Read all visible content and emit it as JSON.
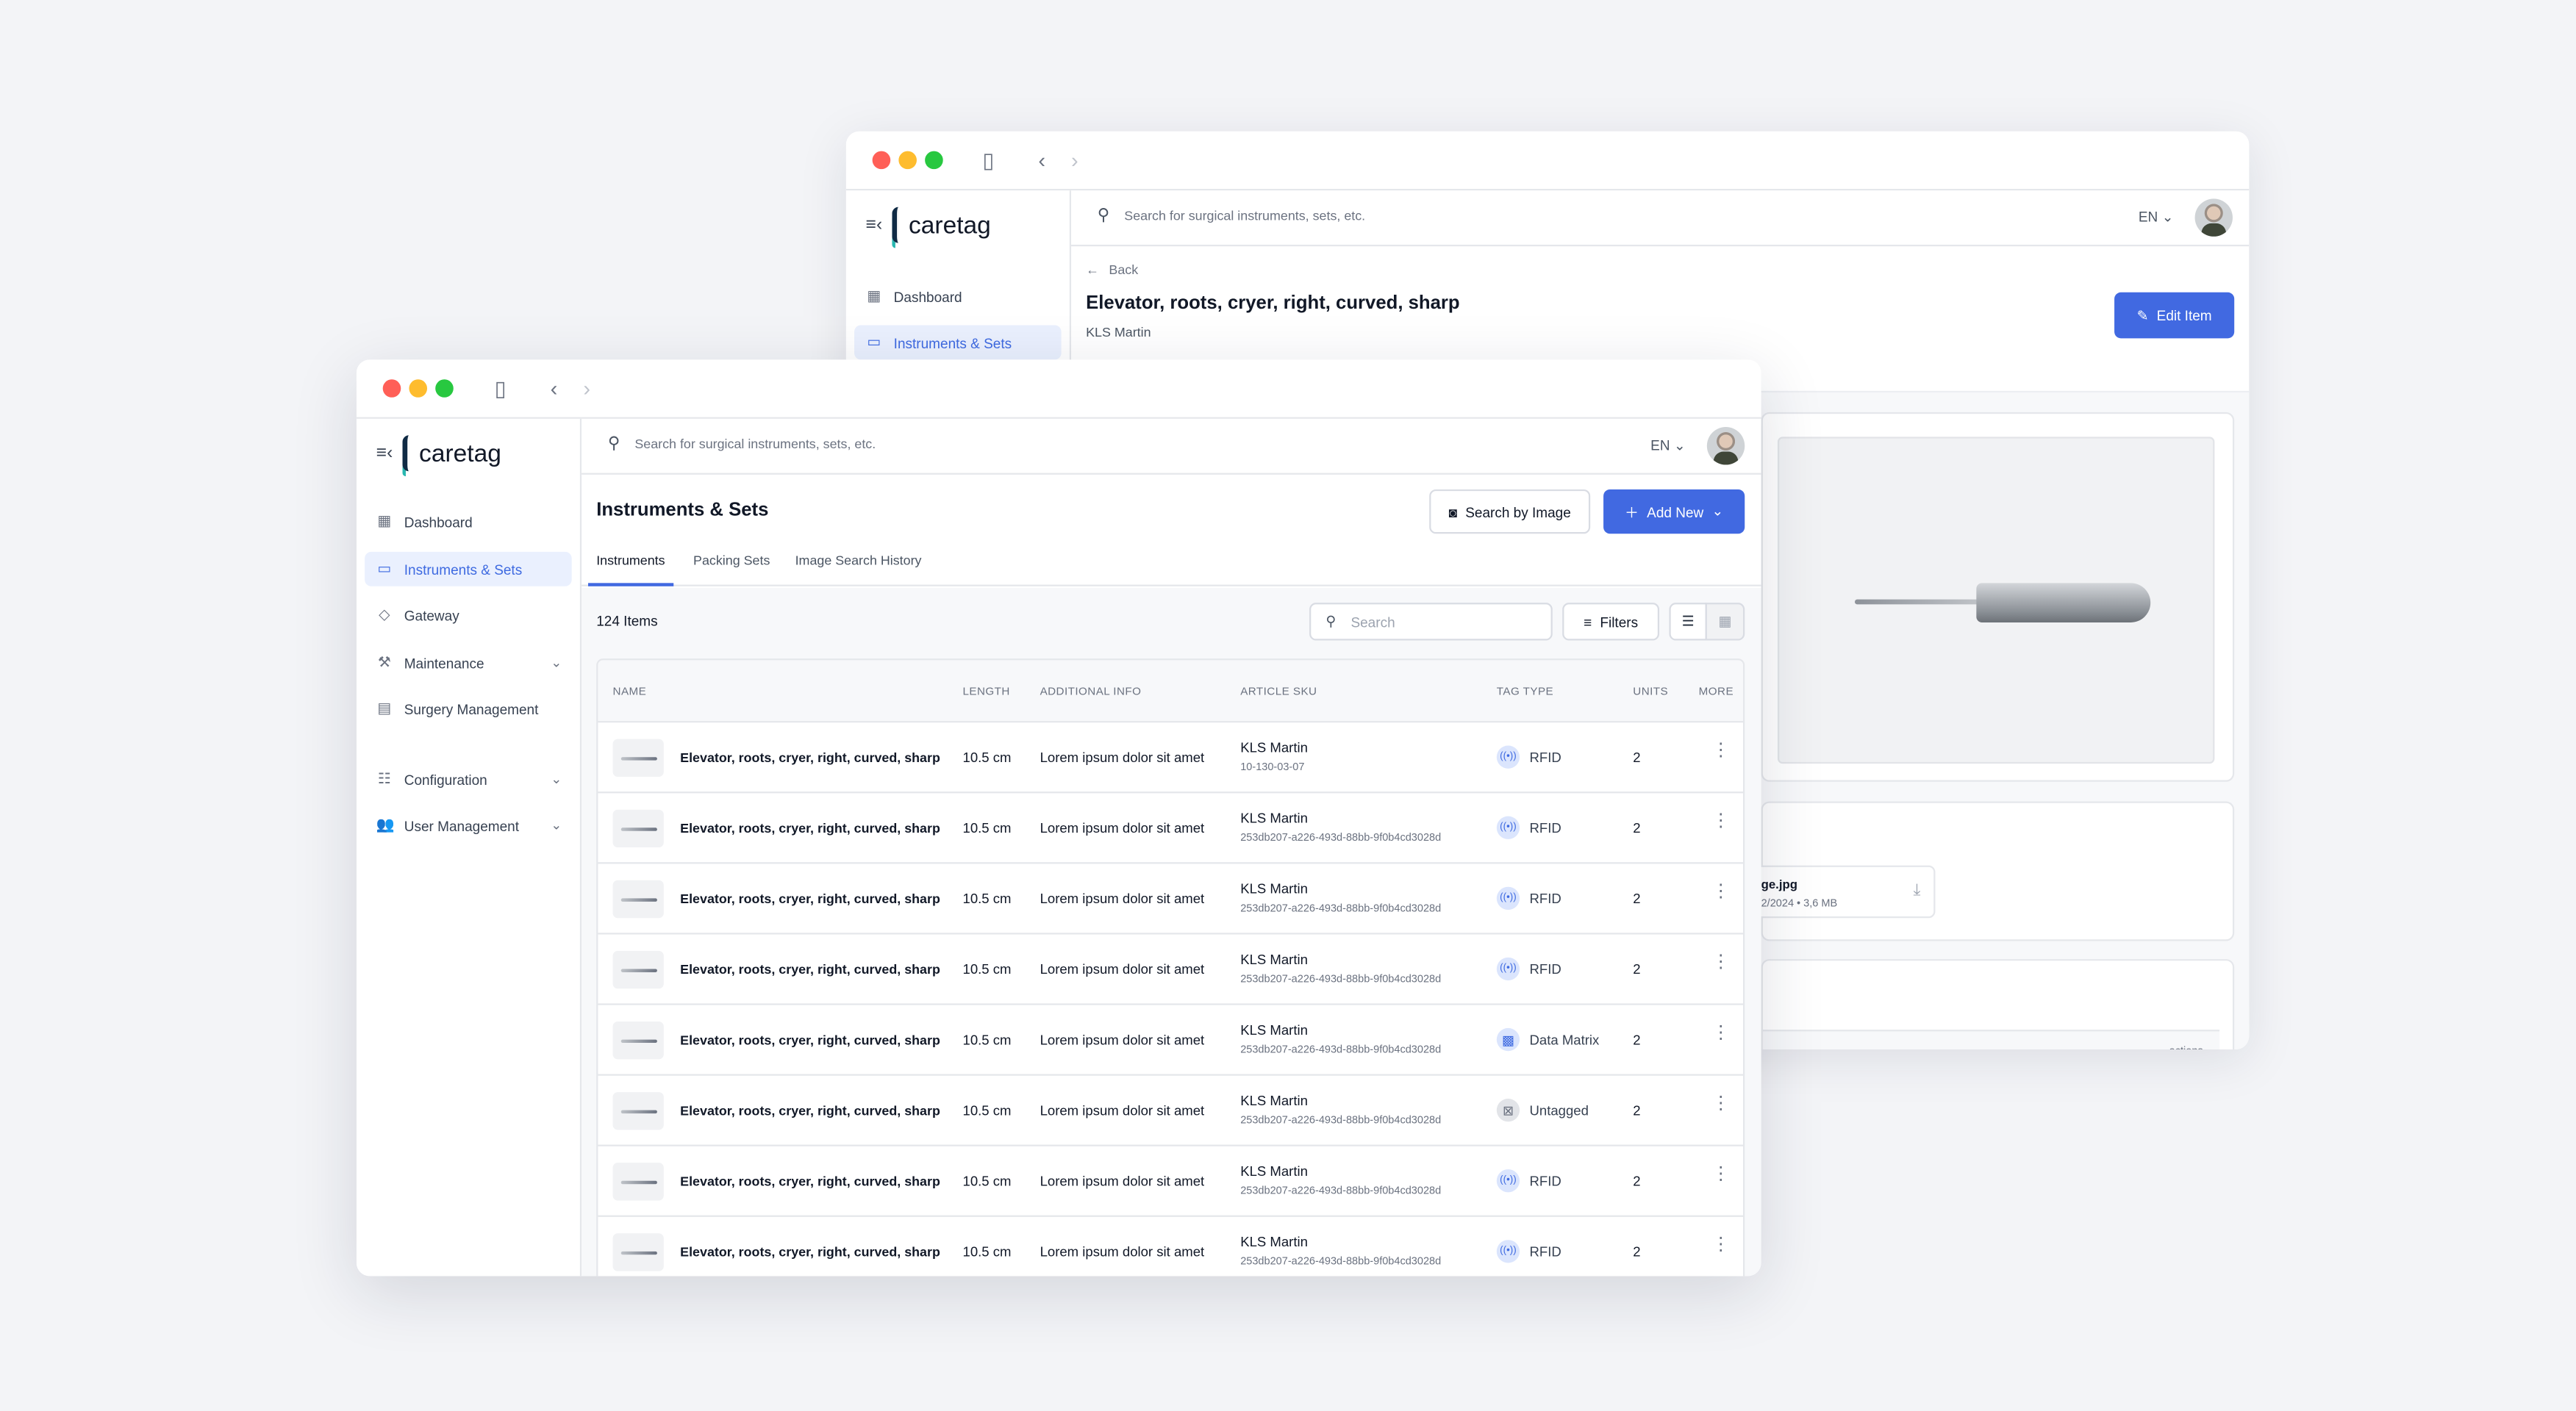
{
  "app": {
    "brand": "caretag",
    "search_placeholder": "Search for surgical instruments, sets, etc.",
    "language": "EN"
  },
  "colors": {
    "accent": "#4169e1",
    "active_nav_bg": "#eaf0fe",
    "close": "#ff5f57",
    "minimize": "#febc2e",
    "maximize": "#28c840"
  },
  "sidebar": {
    "items": [
      {
        "label": "Dashboard",
        "icon": "dashboard-icon"
      },
      {
        "label": "Instruments & Sets",
        "icon": "folder-icon",
        "active": true
      },
      {
        "label": "Gateway",
        "icon": "gateway-icon"
      },
      {
        "label": "Maintenance",
        "icon": "wrench-icon",
        "expandable": true
      },
      {
        "label": "Surgery Management",
        "icon": "list-icon"
      },
      {
        "label": "Configuration",
        "icon": "sliders-icon",
        "expandable": true
      },
      {
        "label": "User Management",
        "icon": "users-icon",
        "expandable": true
      }
    ]
  },
  "detail": {
    "back_label": "Back",
    "title": "Elevator, roots, cryer, right, curved, sharp",
    "manufacturer": "KLS Martin",
    "edit_label": "Edit Item",
    "file_name": "ge.jpg",
    "file_meta": "2/2024 • 3,6 MB",
    "table_actions_label": "actions"
  },
  "list": {
    "title": "Instruments & Sets",
    "search_by_image_label": "Search by Image",
    "add_new_label": "Add New",
    "tabs": [
      {
        "label": "Instruments",
        "active": true
      },
      {
        "label": "Packing Sets"
      },
      {
        "label": "Image Search History"
      }
    ],
    "count_label": "124 Items",
    "search_placeholder": "Search",
    "filters_label": "Filters",
    "columns": [
      "NAME",
      "LENGTH",
      "ADDITIONAL INFO",
      "ARTICLE SKU",
      "TAG TYPE",
      "UNITS",
      "MORE"
    ],
    "rows": [
      {
        "name": "Elevator, roots, cryer, right, curved, sharp",
        "length": "10.5 cm",
        "info": "Lorem ipsum dolor sit amet",
        "brand": "KLS Martin",
        "sku": "10-130-03-07",
        "tag": "RFID",
        "units": "2"
      },
      {
        "name": "Elevator, roots, cryer, right, curved, sharp",
        "length": "10.5 cm",
        "info": "Lorem ipsum dolor sit amet",
        "brand": "KLS Martin",
        "sku": "253db207-a226-493d-88bb-9f0b4cd3028d",
        "tag": "RFID",
        "units": "2"
      },
      {
        "name": "Elevator, roots, cryer, right, curved, sharp",
        "length": "10.5 cm",
        "info": "Lorem ipsum dolor sit amet",
        "brand": "KLS Martin",
        "sku": "253db207-a226-493d-88bb-9f0b4cd3028d",
        "tag": "RFID",
        "units": "2"
      },
      {
        "name": "Elevator, roots, cryer, right, curved, sharp",
        "length": "10.5 cm",
        "info": "Lorem ipsum dolor sit amet",
        "brand": "KLS Martin",
        "sku": "253db207-a226-493d-88bb-9f0b4cd3028d",
        "tag": "RFID",
        "units": "2"
      },
      {
        "name": "Elevator, roots, cryer, right, curved, sharp",
        "length": "10.5 cm",
        "info": "Lorem ipsum dolor sit amet",
        "brand": "KLS Martin",
        "sku": "253db207-a226-493d-88bb-9f0b4cd3028d",
        "tag": "Data Matrix",
        "units": "2"
      },
      {
        "name": "Elevator, roots, cryer, right, curved, sharp",
        "length": "10.5 cm",
        "info": "Lorem ipsum dolor sit amet",
        "brand": "KLS Martin",
        "sku": "253db207-a226-493d-88bb-9f0b4cd3028d",
        "tag": "Untagged",
        "units": "2"
      },
      {
        "name": "Elevator, roots, cryer, right, curved, sharp",
        "length": "10.5 cm",
        "info": "Lorem ipsum dolor sit amet",
        "brand": "KLS Martin",
        "sku": "253db207-a226-493d-88bb-9f0b4cd3028d",
        "tag": "RFID",
        "units": "2"
      },
      {
        "name": "Elevator, roots, cryer, right, curved, sharp",
        "length": "10.5 cm",
        "info": "Lorem ipsum dolor sit amet",
        "brand": "KLS Martin",
        "sku": "253db207-a226-493d-88bb-9f0b4cd3028d",
        "tag": "RFID",
        "units": "2"
      }
    ]
  }
}
